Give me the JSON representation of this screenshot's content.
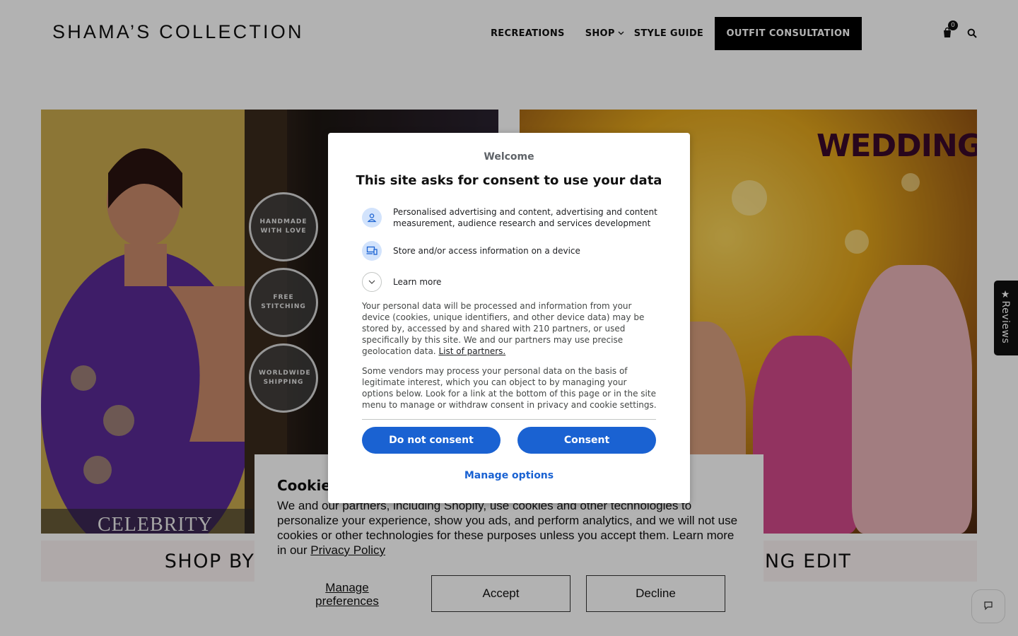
{
  "header": {
    "logo": "SHAMA’S COLLECTION",
    "nav": [
      {
        "label": "RECREATIONS"
      },
      {
        "label": "SHOP"
      },
      {
        "label": "STYLE GUIDE"
      }
    ],
    "cta_label": "OUTFIT CONSULTATION",
    "cart_count": "0",
    "icons": [
      "shopping-bag-icon",
      "search-icon",
      "chevron-down-icon"
    ]
  },
  "hero": {
    "left": {
      "badges": [
        "HANDMADE WITH LOVE",
        "FREE STITCHING",
        "WORLDWIDE SHIPPING"
      ],
      "image_text": "CELEBRITY",
      "caption": "SHOP BY CELEBRITY"
    },
    "right": {
      "image_text": "WEDDING EDIT",
      "caption": "THE WEDDING EDIT"
    }
  },
  "reviews_tab": "★Reviews",
  "cookie_banner": {
    "title": "Cookie consent",
    "text": "We and our partners, including Shopify, use cookies and other technologies to personalize your experience, show you ads, and perform analytics, and we will not use cookies or other technologies for these purposes unless you accept them. Learn more in our ",
    "link": "Privacy Policy",
    "manage_label": "Manage preferences",
    "accept_label": "Accept",
    "decline_label": "Decline"
  },
  "consent_dialog": {
    "welcome": "Welcome",
    "title": "This site asks for consent to use your data",
    "purposes": [
      {
        "icon": "person-icon",
        "text": "Personalised advertising and content, advertising and content measurement, audience research and services development"
      },
      {
        "icon": "devices-icon",
        "text": "Store and/or access information on a device"
      }
    ],
    "learn_more": "Learn more",
    "para1": "Your personal data will be processed and information from your device (cookies, unique identifiers, and other device data) may be stored by, accessed by and shared with 210 partners, or used specifically by this site. We and our partners may use precise geolocation data. ",
    "para1_link": "List of partners.",
    "para2": "Some vendors may process your personal data on the basis of legitimate interest, which you can object to by managing your options below. Look for a link at the bottom of this page or in the site menu to manage or withdraw consent in privacy and cookie settings.",
    "btn_no": "Do not consent",
    "btn_yes": "Consent",
    "manage": "Manage options"
  },
  "colors": {
    "primary_button": "#1a62d2",
    "header_cta": "#000000",
    "caption_bg": "#fbf3f3"
  }
}
